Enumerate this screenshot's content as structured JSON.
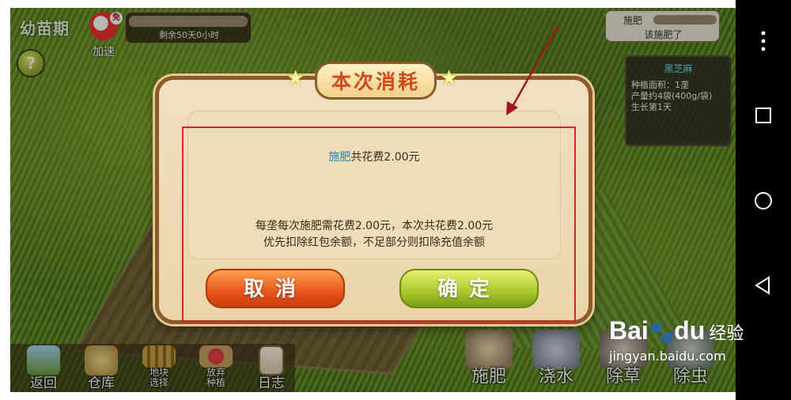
{
  "top_left": {
    "stage": "幼苗期",
    "speed_label": "加速",
    "speed_badge": "免",
    "remaining_time": "剩余50天0小时",
    "help": "?"
  },
  "top_right": {
    "fertilize_title": "施肥",
    "fertilize_status": "该施肥了",
    "crop": {
      "name": "黑芝麻",
      "area": "种植面积：1垄",
      "yield": "产量约4袋(400g/袋)",
      "growth": "生长第1天"
    }
  },
  "dialog": {
    "title": "本次消耗",
    "summary_action": "施肥",
    "summary_rest": "共花费2.00元",
    "detail_line1": "每垄每次施肥需花费2.00元，本次共花费2.00元",
    "detail_line2": "优先扣除红包余额，不足部分则扣除充值余额",
    "cancel_label": "取消",
    "confirm_label": "确定"
  },
  "toolbar_left": [
    {
      "label": "返回",
      "icon": "back-icon"
    },
    {
      "label": "仓库",
      "icon": "warehouse-icon"
    },
    {
      "label": "地块\n选择",
      "icon": "plot-select-icon"
    },
    {
      "label": "放弃\n种植",
      "icon": "abandon-icon"
    },
    {
      "label": "日志",
      "icon": "log-icon"
    }
  ],
  "toolbar_right": [
    {
      "label": "施肥",
      "icon": "fertilize-icon"
    },
    {
      "label": "浇水",
      "icon": "water-icon"
    },
    {
      "label": "除草",
      "icon": "weed-icon"
    },
    {
      "label": "除虫",
      "icon": "pest-icon"
    }
  ],
  "watermark": {
    "logo": "Bai",
    "logo_tail": "du",
    "brand": "经验",
    "url": "jingyan.baidu.com"
  },
  "colors": {
    "dialog_border": "#8a5a2a",
    "dialog_bg": "#f2dfc0",
    "title_text": "#d2481a",
    "highlight": "#1a8ab0",
    "cancel_button": "#e8541a",
    "confirm_button": "#a8c82a",
    "annotation": "#e0202a"
  }
}
